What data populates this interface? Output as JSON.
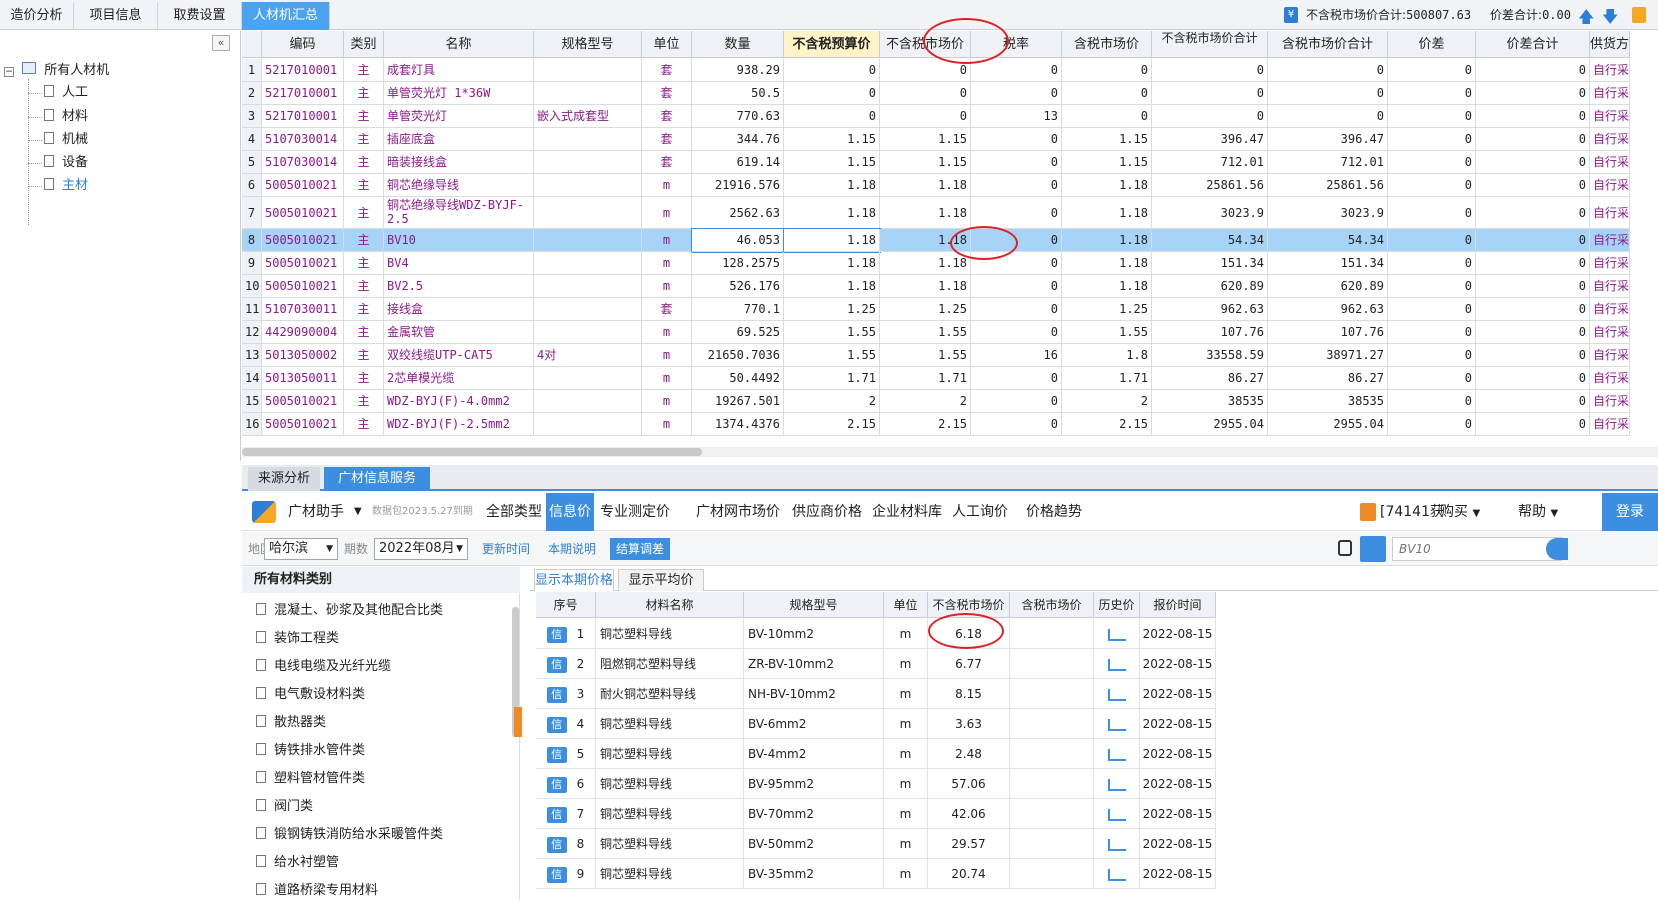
{
  "top": {
    "tabs": [
      "造价分析",
      "项目信息",
      "取费设置",
      "人材机汇总"
    ],
    "active_tab": 3,
    "summary_label": "不含税市场价合计",
    "summary_value": "500807.63",
    "diff_label": "价差合计",
    "diff_value": "0.00"
  },
  "tree": {
    "root": "所有人材机",
    "children": [
      "人工",
      "材料",
      "机械",
      "设备",
      "主材"
    ],
    "selected": 4
  },
  "grid": {
    "headers": [
      "编码",
      "类别",
      "名称",
      "规格型号",
      "单位",
      "数量",
      "不含税预算价",
      "不含税市场价",
      "税率",
      "含税市场价",
      "不含税市场价合计",
      "含税市场价合计",
      "价差",
      "价差合计",
      "供货方"
    ],
    "rows": [
      [
        "1",
        "5217010001",
        "主",
        "成套灯具",
        "",
        "套",
        "938.29",
        "0",
        "0",
        "0",
        "0",
        "0",
        "0",
        "0",
        "0",
        "自行采"
      ],
      [
        "2",
        "5217010001",
        "主",
        "单管荧光灯 1*36W",
        "",
        "套",
        "50.5",
        "0",
        "0",
        "0",
        "0",
        "0",
        "0",
        "0",
        "0",
        "自行采"
      ],
      [
        "3",
        "5217010001",
        "主",
        "单管荧光灯",
        "嵌入式成套型",
        "套",
        "770.63",
        "0",
        "0",
        "13",
        "0",
        "0",
        "0",
        "0",
        "0",
        "自行采"
      ],
      [
        "4",
        "5107030014",
        "主",
        "插座底盒",
        "",
        "套",
        "344.76",
        "1.15",
        "1.15",
        "0",
        "1.15",
        "396.47",
        "396.47",
        "0",
        "0",
        "自行采"
      ],
      [
        "5",
        "5107030014",
        "主",
        "暗装接线盒",
        "",
        "套",
        "619.14",
        "1.15",
        "1.15",
        "0",
        "1.15",
        "712.01",
        "712.01",
        "0",
        "0",
        "自行采"
      ],
      [
        "6",
        "5005010021",
        "主",
        "铜芯绝缘导线",
        "",
        "m",
        "21916.576",
        "1.18",
        "1.18",
        "0",
        "1.18",
        "25861.56",
        "25861.56",
        "0",
        "0",
        "自行采"
      ],
      [
        "7",
        "5005010021",
        "主",
        "铜芯绝缘导线WDZ-BYJF-2.5",
        "",
        "m",
        "2562.63",
        "1.18",
        "1.18",
        "0",
        "1.18",
        "3023.9",
        "3023.9",
        "0",
        "0",
        "自行采"
      ],
      [
        "8",
        "5005010021",
        "主",
        "BV10",
        "",
        "m",
        "46.053",
        "1.18",
        "1.18",
        "0",
        "1.18",
        "54.34",
        "54.34",
        "0",
        "0",
        "自行采"
      ],
      [
        "9",
        "5005010021",
        "主",
        "BV4",
        "",
        "m",
        "128.2575",
        "1.18",
        "1.18",
        "0",
        "1.18",
        "151.34",
        "151.34",
        "0",
        "0",
        "自行采"
      ],
      [
        "10",
        "5005010021",
        "主",
        "BV2.5",
        "",
        "m",
        "526.176",
        "1.18",
        "1.18",
        "0",
        "1.18",
        "620.89",
        "620.89",
        "0",
        "0",
        "自行采"
      ],
      [
        "11",
        "5107030011",
        "主",
        "接线盒",
        "",
        "套",
        "770.1",
        "1.25",
        "1.25",
        "0",
        "1.25",
        "962.63",
        "962.63",
        "0",
        "0",
        "自行采"
      ],
      [
        "12",
        "4429090004",
        "主",
        "金属软管",
        "",
        "m",
        "69.525",
        "1.55",
        "1.55",
        "0",
        "1.55",
        "107.76",
        "107.76",
        "0",
        "0",
        "自行采"
      ],
      [
        "13",
        "5013050002",
        "主",
        "双绞线缆UTP-CAT5",
        "4对",
        "m",
        "21650.7036",
        "1.55",
        "1.55",
        "16",
        "1.8",
        "33558.59",
        "38971.27",
        "0",
        "0",
        "自行采"
      ],
      [
        "14",
        "5013050011",
        "主",
        "2芯单模光缆",
        "",
        "m",
        "50.4492",
        "1.71",
        "1.71",
        "0",
        "1.71",
        "86.27",
        "86.27",
        "0",
        "0",
        "自行采"
      ],
      [
        "15",
        "5005010021",
        "主",
        "WDZ-BYJ(F)-4.0mm2",
        "",
        "m",
        "19267.501",
        "2",
        "2",
        "0",
        "2",
        "38535",
        "38535",
        "0",
        "0",
        "自行采"
      ],
      [
        "16",
        "5005010021",
        "主",
        "WDZ-BYJ(F)-2.5mm2",
        "",
        "m",
        "1374.4376",
        "2.15",
        "2.15",
        "0",
        "2.15",
        "2955.04",
        "2955.04",
        "0",
        "0",
        "自行采"
      ]
    ],
    "selected_row": 8
  },
  "bottom": {
    "tabs": [
      "来源分析",
      "广材信息服务"
    ],
    "helper_title": "广材助手",
    "package": "数据包2023.5.27到期",
    "nav": [
      "全部类型",
      "信息价",
      "专业测定价",
      "广材网市场价",
      "供应商价格",
      "企业材料库",
      "人工询价",
      "价格趋势"
    ],
    "nav_active": 1,
    "account": "[74141获",
    "buy": "购买",
    "help": "帮助",
    "login": "登录",
    "region_label": "地区",
    "region": "哈尔滨",
    "period_label": "期数",
    "period": "2022年08月",
    "btn_update": "更新时间",
    "btn_note": "本期说明",
    "btn_settle": "结算调差",
    "search_placeholder": "BV10",
    "cat_title": "所有材料类别",
    "categories": [
      "混凝土、砂浆及其他配合比类",
      "装饰工程类",
      "电线电缆及光纤光缆",
      "电气敷设材料类",
      "散热器类",
      "铸铁排水管件类",
      "塑料管材管件类",
      "阀门类",
      "锻钢铸铁消防给水采暖管件类",
      "给水衬塑管",
      "道路桥梁专用材料"
    ],
    "price_tabs": [
      "显示本期价格",
      "显示平均价"
    ],
    "price_headers": [
      "序号",
      "材料名称",
      "规格型号",
      "单位",
      "不含税市场价",
      "含税市场价",
      "历史价",
      "报价时间"
    ],
    "price_rows": [
      [
        "信",
        "1",
        "铜芯塑料导线",
        "BV-10mm2",
        "m",
        "6.18",
        "",
        "2022-08-15"
      ],
      [
        "信",
        "2",
        "阻燃铜芯塑料导线",
        "ZR-BV-10mm2",
        "m",
        "6.77",
        "",
        "2022-08-15"
      ],
      [
        "信",
        "3",
        "耐火铜芯塑料导线",
        "NH-BV-10mm2",
        "m",
        "8.15",
        "",
        "2022-08-15"
      ],
      [
        "信",
        "4",
        "铜芯塑料导线",
        "BV-6mm2",
        "m",
        "3.63",
        "",
        "2022-08-15"
      ],
      [
        "信",
        "5",
        "铜芯塑料导线",
        "BV-4mm2",
        "m",
        "2.48",
        "",
        "2022-08-15"
      ],
      [
        "信",
        "6",
        "铜芯塑料导线",
        "BV-95mm2",
        "m",
        "57.06",
        "",
        "2022-08-15"
      ],
      [
        "信",
        "7",
        "铜芯塑料导线",
        "BV-70mm2",
        "m",
        "42.06",
        "",
        "2022-08-15"
      ],
      [
        "信",
        "8",
        "铜芯塑料导线",
        "BV-50mm2",
        "m",
        "29.57",
        "",
        "2022-08-15"
      ],
      [
        "信",
        "9",
        "铜芯塑料导线",
        "BV-35mm2",
        "m",
        "20.74",
        "",
        "2022-08-15"
      ]
    ]
  },
  "colors": {
    "accent": "#3c8fe0",
    "selected_row": "#a7d3f7",
    "grid_text": "#8a1a8a",
    "annotation": "#e02020"
  }
}
